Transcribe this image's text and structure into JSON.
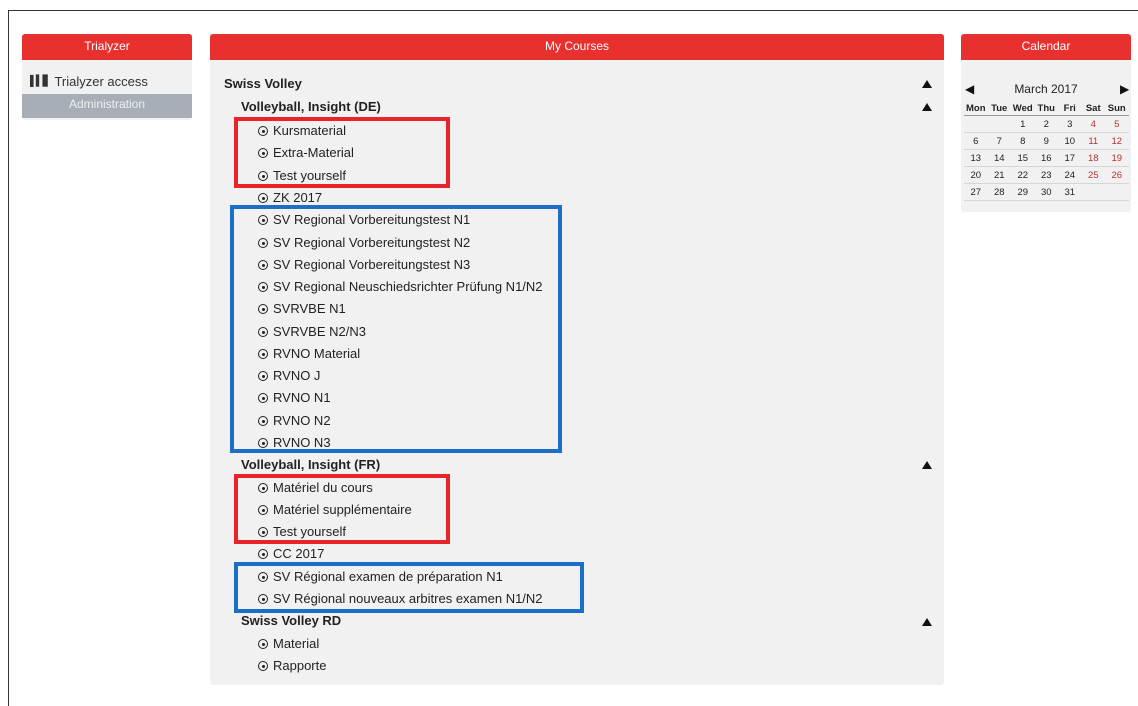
{
  "trialyzer": {
    "title": "Trialyzer",
    "access_label": "Trialyzer access",
    "admin_label": "Administration"
  },
  "courses": {
    "title": "My Courses",
    "group1": "Swiss Volley",
    "sub_de": "Volleyball, Insight (DE)",
    "de_items": [
      "Kursmaterial",
      "Extra-Material",
      "Test yourself",
      "ZK 2017",
      "SV Regional Vorbereitungstest N1",
      "SV Regional Vorbereitungstest N2",
      "SV Regional Vorbereitungstest N3",
      "SV Regional Neuschiedsrichter Prüfung N1/N2",
      "SVRVBE N1",
      "SVRVBE N2/N3",
      "RVNO Material",
      "RVNO J",
      "RVNO N1",
      "RVNO N2",
      "RVNO N3"
    ],
    "sub_fr": "Volleyball, Insight (FR)",
    "fr_items": [
      "Matériel du cours",
      "Matériel supplémentaire",
      "Test yourself",
      "CC 2017",
      "SV Régional examen de préparation N1",
      "SV Régional nouveaux arbitres examen N1/N2"
    ],
    "sub_rd": "Swiss Volley RD",
    "rd_items": [
      "Material",
      "Rapporte"
    ]
  },
  "calendar": {
    "title": "Calendar",
    "month": "March 2017",
    "prev": "◀",
    "next": "▶",
    "weekdays": [
      "Mon",
      "Tue",
      "Wed",
      "Thu",
      "Fri",
      "Sat",
      "Sun"
    ],
    "weeks": [
      [
        "",
        "",
        "1",
        "2",
        "3",
        "4",
        "5"
      ],
      [
        "6",
        "7",
        "8",
        "9",
        "10",
        "11",
        "12"
      ],
      [
        "13",
        "14",
        "15",
        "16",
        "17",
        "18",
        "19"
      ],
      [
        "20",
        "21",
        "22",
        "23",
        "24",
        "25",
        "26"
      ],
      [
        "27",
        "28",
        "29",
        "30",
        "31",
        "",
        ""
      ]
    ]
  },
  "colors": {
    "header_red": "#e8302f",
    "highlight_red": "#e8232a",
    "highlight_blue": "#1b6fc7",
    "weekend_text": "#b5322e"
  }
}
